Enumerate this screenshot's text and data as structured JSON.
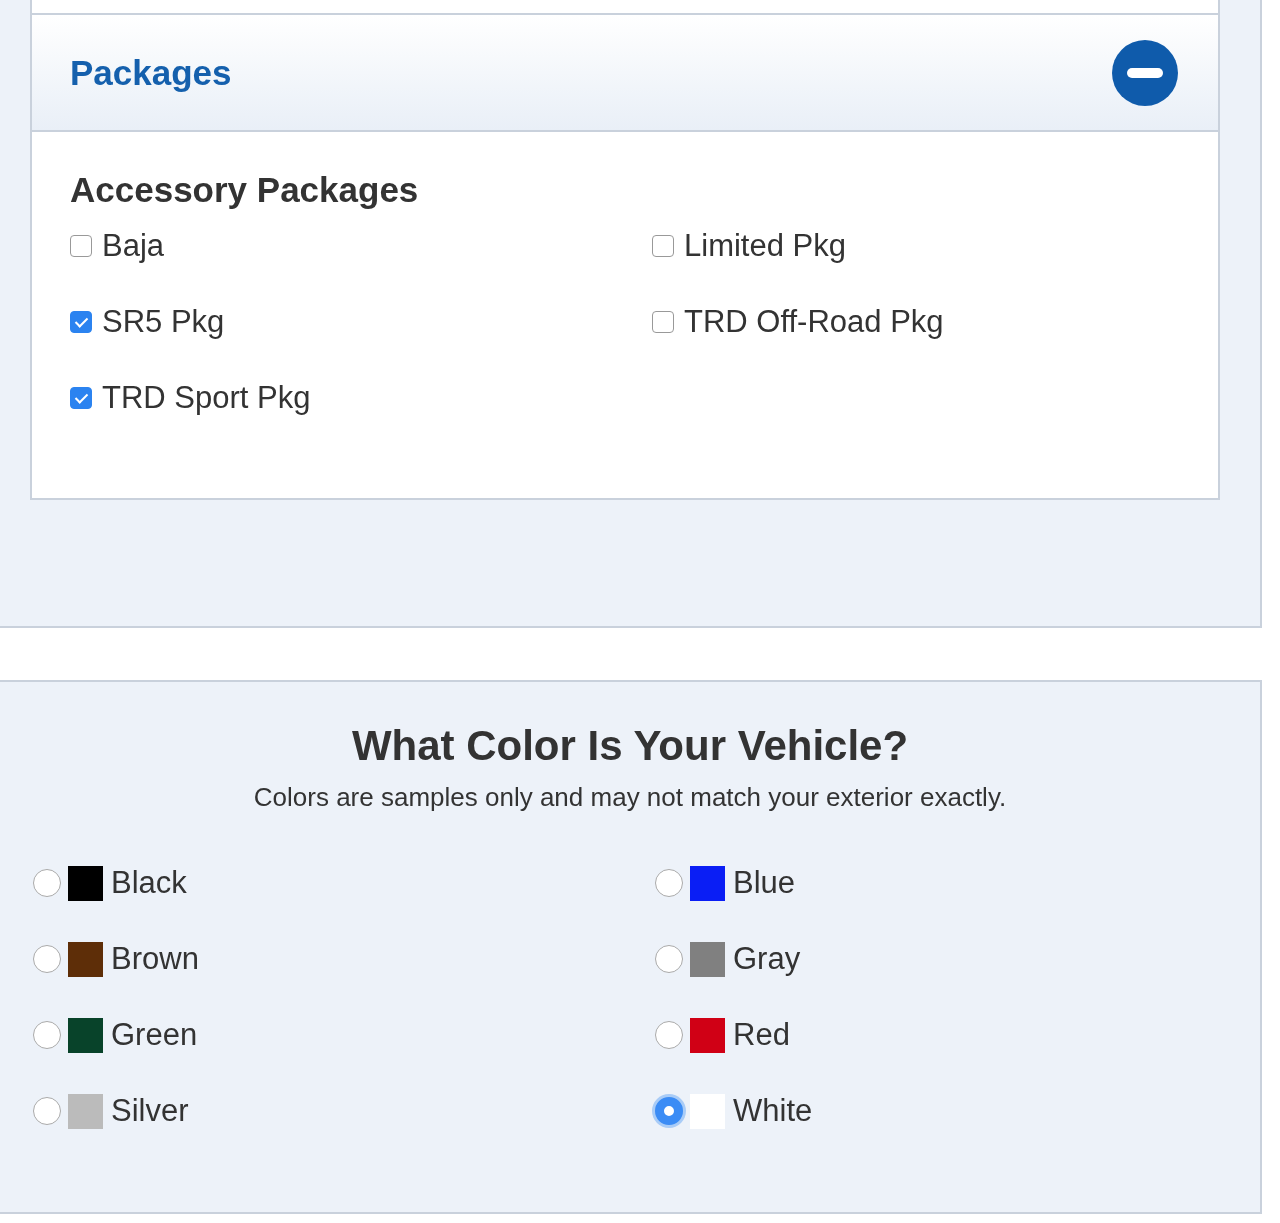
{
  "packages_section": {
    "title": "Packages",
    "expanded": true,
    "group_title": "Accessory Packages",
    "options": [
      {
        "label": "Baja",
        "checked": false
      },
      {
        "label": "Limited Pkg",
        "checked": false
      },
      {
        "label": "SR5 Pkg",
        "checked": true
      },
      {
        "label": "TRD Off-Road Pkg",
        "checked": false
      },
      {
        "label": "TRD Sport Pkg",
        "checked": true
      }
    ]
  },
  "color_section": {
    "title": "What Color Is Your Vehicle?",
    "subtitle": "Colors are samples only and may not match your exterior exactly.",
    "colors": [
      {
        "label": "Black",
        "color": "#000000",
        "selected": false
      },
      {
        "label": "Blue",
        "color": "#0a1ef5",
        "selected": false
      },
      {
        "label": "Brown",
        "color": "#5e2e08",
        "selected": false
      },
      {
        "label": "Gray",
        "color": "#808080",
        "selected": false
      },
      {
        "label": "Green",
        "color": "#08432a",
        "selected": false
      },
      {
        "label": "Red",
        "color": "#d00015",
        "selected": false
      },
      {
        "label": "Silver",
        "color": "#bbbbbb",
        "selected": false
      },
      {
        "label": "White",
        "color": "#ffffff",
        "selected": true
      }
    ]
  }
}
